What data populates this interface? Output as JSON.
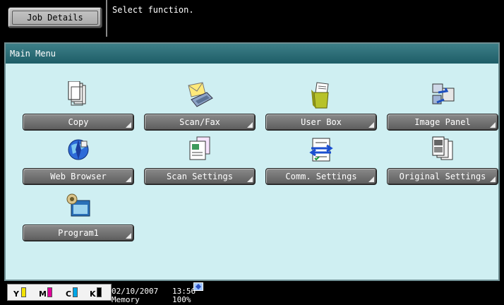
{
  "header": {
    "job_details_label": "Job Details",
    "message": "Select function."
  },
  "panel": {
    "title": "Main Menu"
  },
  "functions": [
    {
      "label": "Copy",
      "icon": "copy-icon"
    },
    {
      "label": "Scan/Fax",
      "icon": "scan-fax-icon"
    },
    {
      "label": "User Box",
      "icon": "user-box-icon"
    },
    {
      "label": "Image Panel",
      "icon": "image-panel-icon"
    },
    {
      "label": "Web Browser",
      "icon": "web-browser-icon"
    },
    {
      "label": "Scan Settings",
      "icon": "scan-settings-icon"
    },
    {
      "label": "Comm. Settings",
      "icon": "comm-settings-icon"
    },
    {
      "label": "Original Settings",
      "icon": "original-settings-icon"
    },
    {
      "label": "Program1",
      "icon": "program-icon"
    }
  ],
  "status": {
    "toner": [
      {
        "letter": "Y",
        "color": "#f4e300"
      },
      {
        "letter": "M",
        "color": "#e0009a"
      },
      {
        "letter": "C",
        "color": "#00a7e8"
      },
      {
        "letter": "K",
        "color": "#000000"
      }
    ],
    "date": "02/10/2007",
    "time": "13:56",
    "memory_label": "Memory",
    "memory_value": "100%"
  }
}
